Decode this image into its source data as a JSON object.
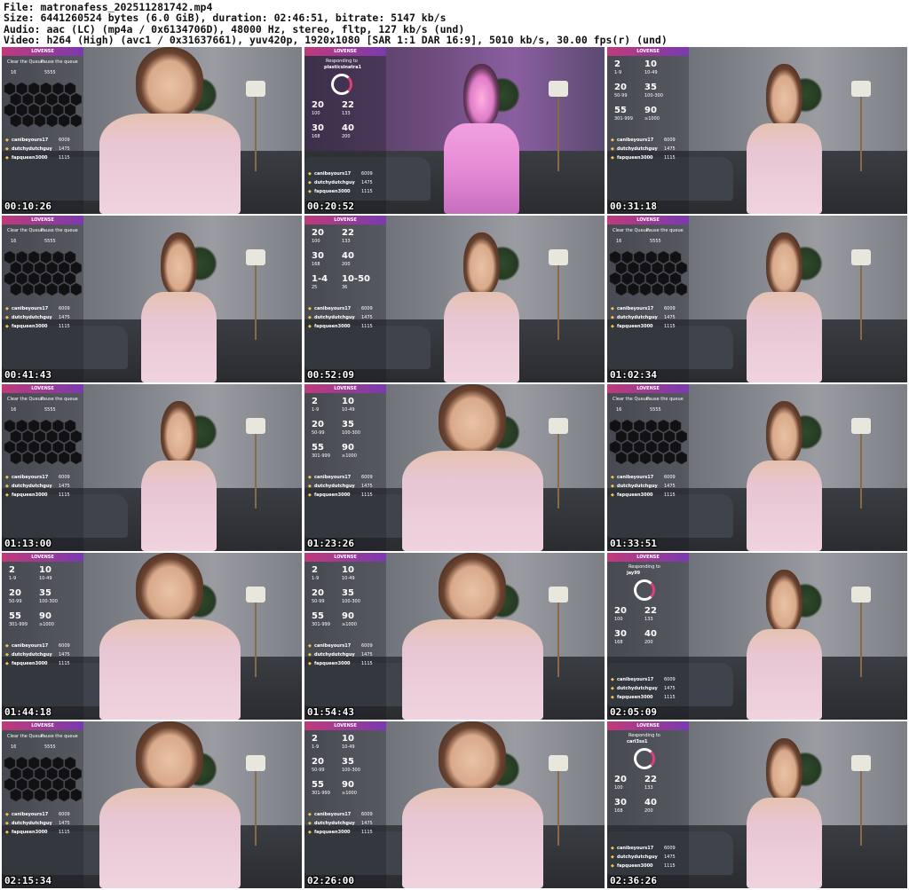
{
  "header": {
    "file_line": "File: matronafess_202511281742.mp4",
    "size_line": "Size: 6441260524 bytes (6.0 GiB), duration: 02:46:51, bitrate: 5147 kb/s",
    "audio_line": "Audio: aac (LC) (mp4a / 0x6134706D), 48000 Hz, stereo, fltp, 127 kb/s (und)",
    "video_line": "Video: h264 (High) (avc1 / 0x31637661), yuv420p, 1920x1080 [SAR 1:1 DAR 16:9], 5010 kb/s, 30.00 fps(r) (und)"
  },
  "overlay_labels": {
    "banner": "LOVENSE",
    "clear_queue": "Clear the Queue",
    "pause_queue": "Pause the queue",
    "clear_value": "16",
    "pause_value": "5555",
    "responding_to": "Responding to",
    "tiers": [
      {
        "big": "2",
        "small": "1-9"
      },
      {
        "big": "10",
        "small": "10-49"
      },
      {
        "big": "20",
        "small": "50-99"
      },
      {
        "big": "35",
        "small": "100-300"
      },
      {
        "big": "55",
        "small": "301-999"
      },
      {
        "big": "90",
        "small": "≥1000"
      }
    ],
    "tiers_alt": [
      {
        "big": "20",
        "small": "100"
      },
      {
        "big": "22",
        "small": "133"
      },
      {
        "big": "30",
        "small": "168"
      },
      {
        "big": "40",
        "small": "200"
      },
      {
        "big": "1-4",
        "small": "25"
      },
      {
        "big": "10-50",
        "small": "36"
      }
    ],
    "leaderboard": [
      {
        "name": "canibeyours17",
        "count": "6009"
      },
      {
        "name": "dutchydutchguy",
        "count": "1475"
      },
      {
        "name": "fapqueen3000",
        "count": "1115"
      }
    ]
  },
  "thumbnails": [
    {
      "time": "00:10:26",
      "scene": "close",
      "panel": "queue",
      "responder": ""
    },
    {
      "time": "00:20:52",
      "scene": "pink",
      "panel": "respond",
      "responder": "plasticsinatra1"
    },
    {
      "time": "00:31:18",
      "scene": "wide",
      "panel": "tiers",
      "responder": ""
    },
    {
      "time": "00:41:43",
      "scene": "wide",
      "panel": "queue",
      "responder": ""
    },
    {
      "time": "00:52:09",
      "scene": "wide",
      "panel": "tiers_alt",
      "responder": ""
    },
    {
      "time": "01:02:34",
      "scene": "wide",
      "panel": "queue",
      "responder": ""
    },
    {
      "time": "01:13:00",
      "scene": "wide",
      "panel": "queue",
      "responder": ""
    },
    {
      "time": "01:23:26",
      "scene": "close",
      "panel": "tiers",
      "responder": ""
    },
    {
      "time": "01:33:51",
      "scene": "wide",
      "panel": "queue",
      "responder": ""
    },
    {
      "time": "01:44:18",
      "scene": "close",
      "panel": "tiers",
      "responder": ""
    },
    {
      "time": "01:54:43",
      "scene": "close",
      "panel": "tiers",
      "responder": ""
    },
    {
      "time": "02:05:09",
      "scene": "wide",
      "panel": "respond",
      "responder": "jay99"
    },
    {
      "time": "02:15:34",
      "scene": "close",
      "panel": "queue",
      "responder": ""
    },
    {
      "time": "02:26:00",
      "scene": "close",
      "panel": "tiers",
      "responder": ""
    },
    {
      "time": "02:36:26",
      "scene": "wide",
      "panel": "respond",
      "responder": "carl3ss1"
    }
  ]
}
